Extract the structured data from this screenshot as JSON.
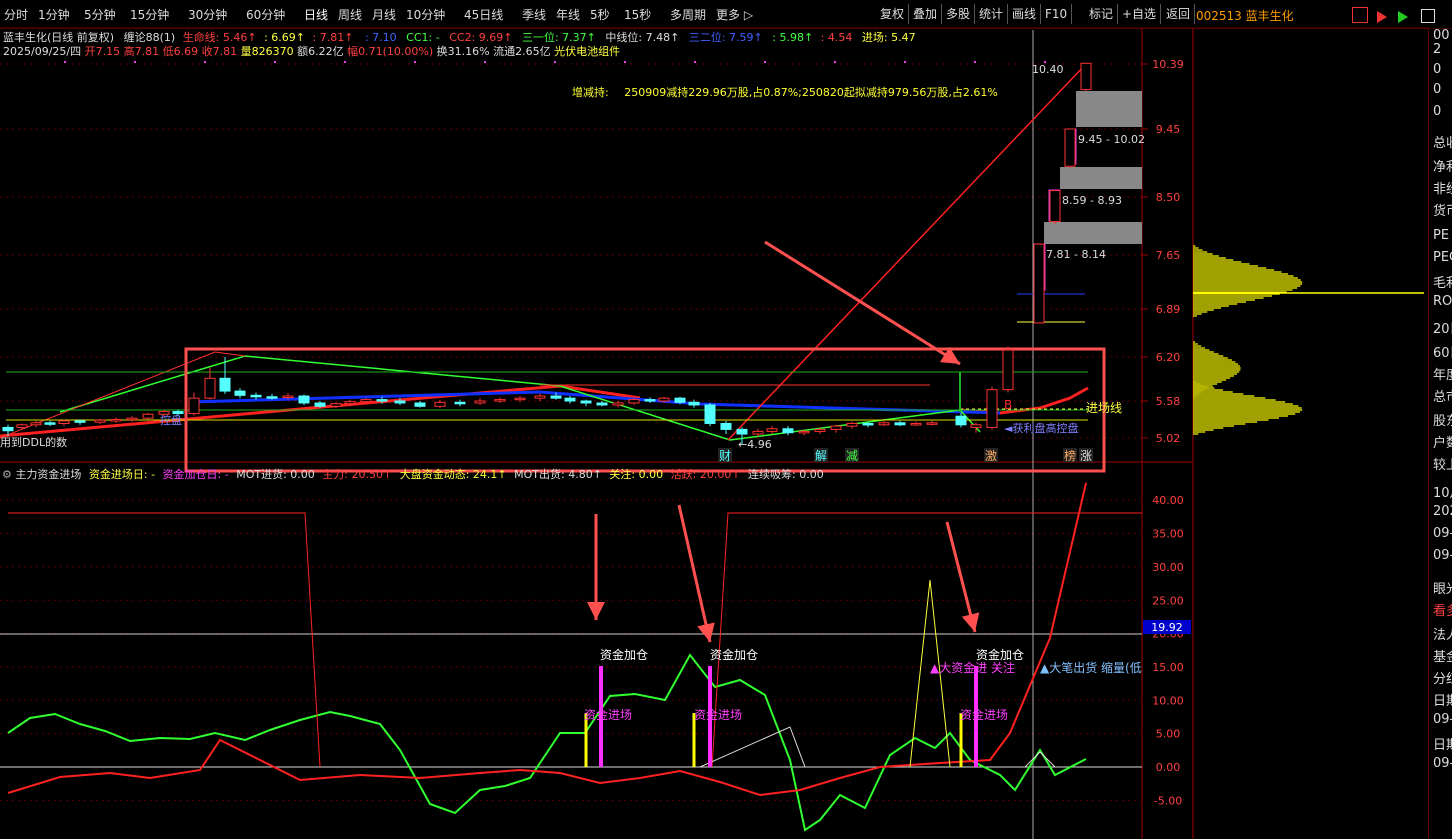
{
  "toolbar": {
    "left_items": [
      "分时",
      "1分钟",
      "5分钟",
      "15分钟",
      "30分钟",
      "60分钟",
      "日线",
      "周线",
      "月线",
      "10分钟",
      "45日线",
      "季线",
      "年线",
      "5秒",
      "15秒",
      "多周期",
      "更多 ▷"
    ],
    "right_items": [
      "复权",
      "叠加",
      "多股",
      "统计",
      "画线",
      "F10",
      "标记",
      "+自选",
      "返回"
    ],
    "stock_title": "002513 蓝丰生化"
  },
  "header": {
    "name": "蓝丰生化(日线 前复权)",
    "indicator": "缠论88(1)",
    "lifeline": "生命线: 5.46↑",
    "v1": ": 6.69↑",
    "v2": ": 7.81↑",
    "v3": ": 7.10",
    "cc1": "CC1: -",
    "cc2": "CC2: 9.69↑",
    "third_buy": "三一位: 7.37↑",
    "mid": "中线位: 7.48↑",
    "third_two": "三二位: 7.59↑",
    "v4": ": 5.98↑",
    "v5": ": 4.54",
    "entry": "进场: 5.47"
  },
  "quote": {
    "date": "2025/09/25/四",
    "open": "开7.15",
    "high": "高7.81",
    "low": "低6.69",
    "close": "收7.81",
    "volume": "量826370",
    "amount": "额6.22亿",
    "change": "幅0.71(10.00%)",
    "turnover": "换31.16%",
    "float": "流通2.65亿",
    "sector": "光伏电池组件"
  },
  "announcement": {
    "label": "增减持:",
    "text": "250909减持229.96万股,占0.87%;250820起拟减持979.56万股,占2.61%"
  },
  "price_axis": [
    "10.39",
    "9.45",
    "8.50",
    "7.65",
    "6.89",
    "6.20",
    "5.58",
    "5.02"
  ],
  "price_labels": {
    "peak": "10.40",
    "low": "4.96",
    "band1": "9.45 - 10.02",
    "band2": "8.59 - 8.93",
    "band3": "7.81 - 8.14",
    "entry_line": "进场线",
    "profit_text": "获利盘高控盘",
    "left_text1": "控盘",
    "left_text2": "用到DDL的数"
  },
  "markers": [
    "财",
    "解",
    "减",
    "激",
    "榜",
    "涨"
  ],
  "indicator_header": {
    "name": "主力资金进场",
    "f1": "资金进场日: -",
    "f2": "资金加仓日: -",
    "f3": "MOT进货: 0.00",
    "f4": "主力: 20.50↑",
    "f5": "大盘资金动态: 24.1↑",
    "f6": "MOT出货: 4.80↑",
    "f7": "关注: 0.00",
    "f8": "活跃: 20.00↑",
    "f9": "连续吸筹: 0.00"
  },
  "indicator_axis": [
    "40.00",
    "35.00",
    "30.00",
    "25.00",
    "20.00",
    "15.00",
    "10.00",
    "5.00",
    "0.00",
    "-5.00"
  ],
  "indicator_current": "19.92",
  "indicator_labels": {
    "add1": "资金加仓",
    "add2": "资金加仓",
    "add3": "资金加仓",
    "enter1": "资金进场",
    "enter2": "资金进场",
    "enter3": "资金进场",
    "big_in": "▲大资金进 关注",
    "big_out": "▲大笔出货 缩量(低"
  },
  "right_panel": [
    "00",
    "2",
    "0",
    "0",
    "0",
    "总收",
    "净利",
    "非经",
    "货币",
    "PE",
    "PEG",
    "毛利",
    "ROE",
    "20日",
    "60日",
    "年度",
    "总市",
    "股东",
    "户数",
    "较上",
    "10月",
    "202",
    "09-",
    "09-",
    "眼光",
    "看多",
    "法人",
    "基金",
    "分红",
    "日期",
    "09-",
    "日期",
    "09-"
  ],
  "colors": {
    "up": "#ff3232",
    "down": "#54ffff",
    "bg": "#000000",
    "grid": "#7a0000",
    "accent": "#ffff00"
  },
  "chart_data": [
    {
      "type": "candlestick",
      "title": "蓝丰生化(日线 前复权)",
      "y_ticks": [
        10.39,
        9.45,
        8.5,
        7.65,
        6.89,
        6.2,
        5.58,
        5.02
      ],
      "ylim": [
        4.7,
        10.6
      ],
      "last": {
        "open": 7.15,
        "high": 7.81,
        "low": 6.69,
        "close": 7.81
      },
      "annotations": {
        "peak": 10.4,
        "low": 4.96
      }
    },
    {
      "type": "line",
      "title": "主力资金进场",
      "y_ticks": [
        40,
        35,
        30,
        25,
        20,
        15,
        10,
        5,
        0,
        -5
      ],
      "ylim": [
        -10,
        44
      ],
      "current": 19.92
    }
  ]
}
